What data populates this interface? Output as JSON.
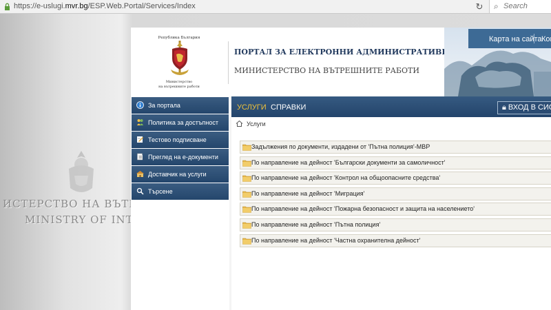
{
  "browser": {
    "url_prefix": "https://e-uslugi.",
    "url_domain": "mvr.bg",
    "url_path": "/ESP.Web.Portal/Services/Index",
    "search_placeholder": "Search"
  },
  "background": {
    "text_line1": "ИСТЕРСТВО НА ВЪТРЕШНИ",
    "text_line2": "MINISTRY OF INTERIOR"
  },
  "header": {
    "logo_top": "Република България",
    "logo_bottom_line1": "Министерство",
    "logo_bottom_line2": "на вътрешните работи",
    "portal_title": "ПОРТАЛ ЗА ЕЛЕКТРОННИ АДМИНИСТРАТИВНИ УСЛУГИ",
    "ministry_title": "МИНИСТЕРСТВО НА ВЪТРЕШНИТЕ РАБОТИ",
    "top_links": [
      "Карта на сайта",
      "Конт"
    ]
  },
  "nav": {
    "tabs": [
      "УСЛУГИ",
      "СПРАВКИ"
    ],
    "login_label": "ВХОД В СИСТЕ"
  },
  "breadcrumb": {
    "label": "Услуги"
  },
  "sidebar": {
    "items": [
      {
        "label": "За портала",
        "icon": "info-icon"
      },
      {
        "label": "Политика за достъпност",
        "icon": "accessibility-icon"
      },
      {
        "label": "Тестово подписване",
        "icon": "signature-icon"
      },
      {
        "label": "Преглед на е-документи",
        "icon": "document-icon"
      },
      {
        "label": "Доставчик на услуги",
        "icon": "provider-icon"
      },
      {
        "label": "Търсене",
        "icon": "search-icon"
      }
    ]
  },
  "services": [
    "Задължения по документи, издадени от 'Пътна полиция'-МВР",
    "По направление на дейност 'Български документи за самоличност'",
    "По направление на дейност 'Контрол на общоопасните средства'",
    "По направление на дейност 'Миграция'",
    "По направление на дейност 'Пожарна безопасност и защита на населението'",
    "По направление на дейност 'Пътна полиция'",
    "По направление на дейност 'Частна охранителна дейност'"
  ],
  "colors": {
    "nav_blue": "#2b4c73",
    "active_tab": "#f0c23a",
    "title_blue": "#223a5e",
    "folder_yellow": "#e8b84a"
  }
}
